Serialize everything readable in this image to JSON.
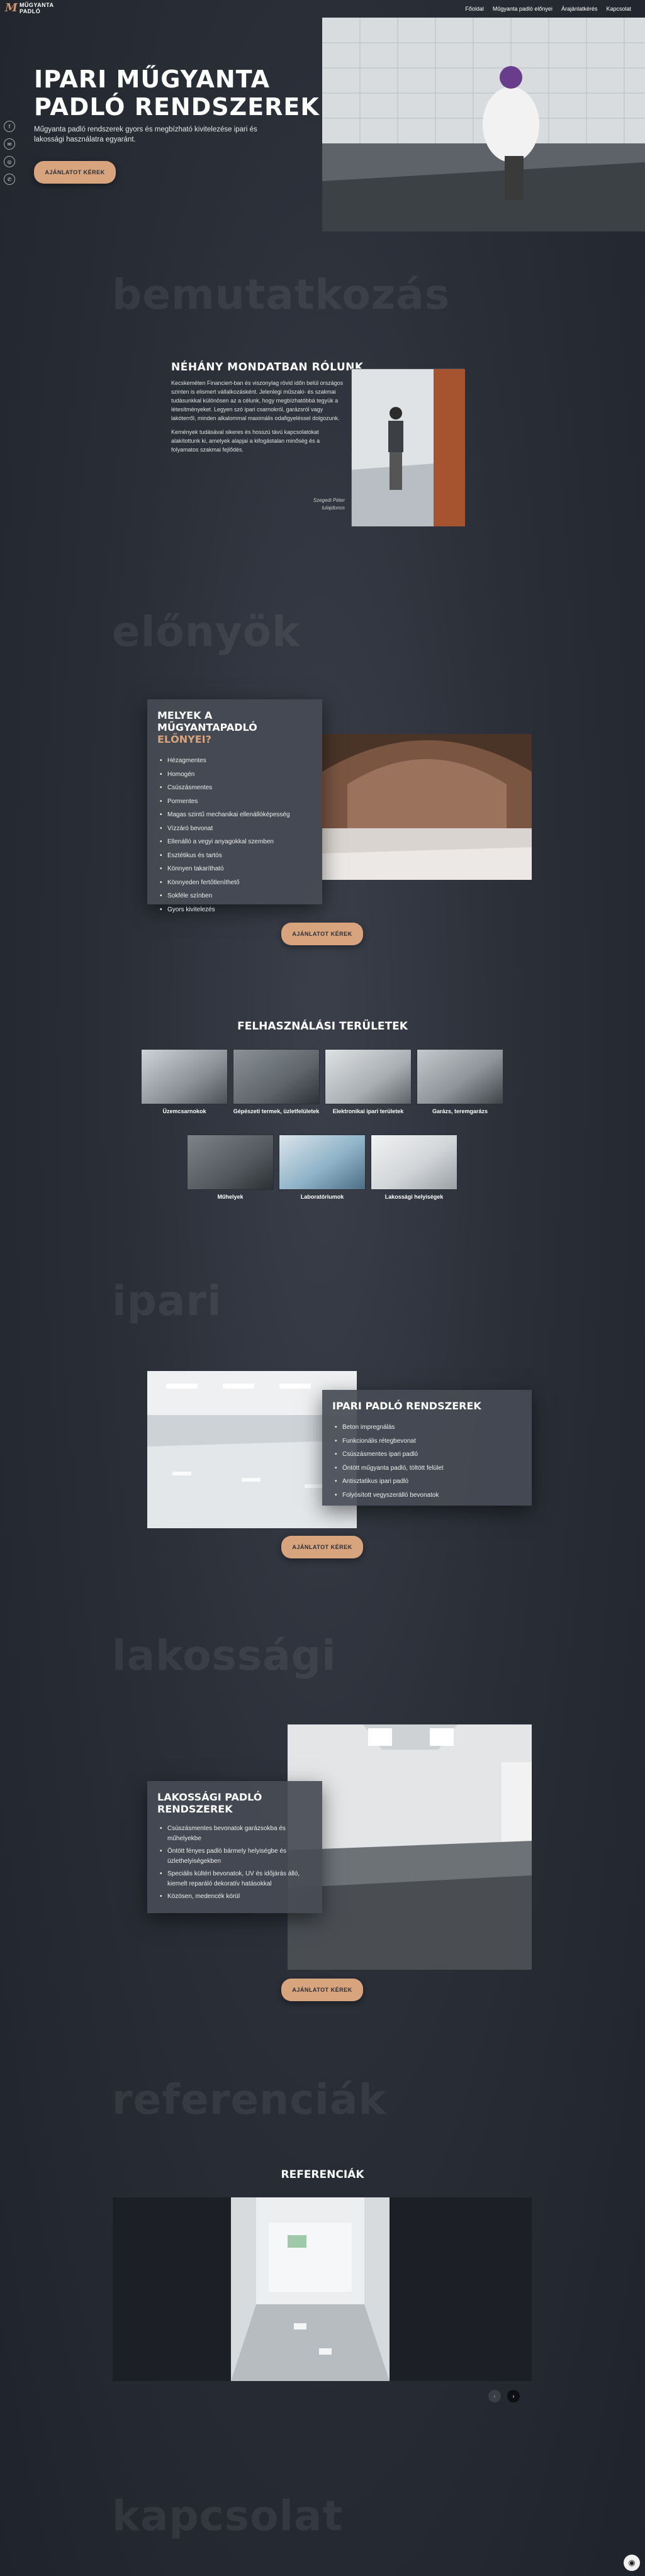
{
  "header": {
    "logo_mark": "M",
    "logo_line1": "MŰGYANTA",
    "logo_line2": "PADLÓ",
    "nav": [
      "Főoldal",
      "Műgyanta padló előnyei",
      "Árajánlatkérés",
      "Kapcsolat"
    ]
  },
  "hero": {
    "title_line1": "IPARI MŰGYANTA",
    "title_line2": "PADLÓ RENDSZEREK",
    "subtitle": "Műgyanta padló rendszerek gyors és megbízható kivitelezése ipari és lakossági használatra egyaránt.",
    "button": "AJÁNLATOT KÉREK",
    "social_icons": [
      "facebook-icon",
      "email-icon",
      "instagram-icon",
      "phone-icon"
    ],
    "social_glyphs": [
      "f",
      "✉",
      "◎",
      "✆"
    ]
  },
  "sections": {
    "about_watermark": "bemutatkozás",
    "advantages_watermark": "előnyök",
    "industrial_watermark": "ipari",
    "residential_watermark": "lakossági",
    "references_watermark": "referenciák",
    "contact_watermark": "kapcsolat"
  },
  "about": {
    "title": "NÉHÁNY MONDATBAN RÓLUNK",
    "paragraph1": "Kecskeméten Financiert-ban és viszonylag rövid időn belül országos szinten is elismert vállalkozásként. Jelenlegi műszaki- és szakmai tudásunkkal különösen az a célunk, hogy megbízhatóbbá tegyük a létesítményeket. Legyen szó ipari csarnokról, garázsról vagy lakóterről, minden alkalommal maximális odafigyeléssel dolgozunk.",
    "paragraph2": "Kemények tudásával sikeres és hosszú távú kapcsolatokat alakítottunk ki, amelyek alapjai a kifogástalan minőség és a folyamatos szakmai fejlődés.",
    "signature_name": "Szegedi Péter",
    "signature_role": "tulajdonos"
  },
  "advantages": {
    "title": "MELYEK A MŰGYANTAPADLÓ",
    "title_accent": "ELŐNYEI?",
    "items": [
      "Hézagmentes",
      "Homogén",
      "Csúszásmentes",
      "Pormentes",
      "Magas szintű mechanikai ellenállóképesség",
      "Vízzáró bevonat",
      "Ellenálló a vegyi anyagokkal szemben",
      "Esztétikus és tartós",
      "Könnyen takarítható",
      "Könnyeden fertőtleníthető",
      "Sokféle színben",
      "Gyors kivitelezés"
    ],
    "button": "AJÁNLATOT KÉREK"
  },
  "areas": {
    "title": "FELHASZNÁLÁSI TERÜLETEK",
    "items": [
      "Üzemcsarnokok",
      "Gépészeti termek, üzletfelületek",
      "Elektronikai ipari területek",
      "Garázs, teremgarázs",
      "Műhelyek",
      "Laboratóriumok",
      "Lakossági helyiségek"
    ]
  },
  "industrial": {
    "title": "IPARI PADLÓ RENDSZEREK",
    "items": [
      "Beton impregnálás",
      "Funkcionális rétegbevonat",
      "Csúszásmentes ipari padló",
      "Öntött műgyanta padló, töltött felület",
      "Antisztatikus ipari padló",
      "Folyósított vegyszerálló bevonatok"
    ],
    "button": "AJÁNLATOT KÉREK"
  },
  "residential": {
    "title": "LAKOSSÁGI PADLÓ RENDSZEREK",
    "items": [
      "Csúszásmentes bevonatok garázsokba és műhelyekbe",
      "Öntött fényes padló bármely helyiségbe és üzlethelyiségekben",
      "Speciális kültéri bevonatok, UV és időjárás álló, kiemelt reparáló dekoratív hatásokkal",
      "Közösen, medencék körül"
    ],
    "button": "AJÁNLATOT KÉREK"
  },
  "references": {
    "title": "REFERENCIÁK",
    "prev": "‹",
    "next": "›"
  },
  "chat": {
    "icon": "chat-icon",
    "glyph": "◉"
  }
}
